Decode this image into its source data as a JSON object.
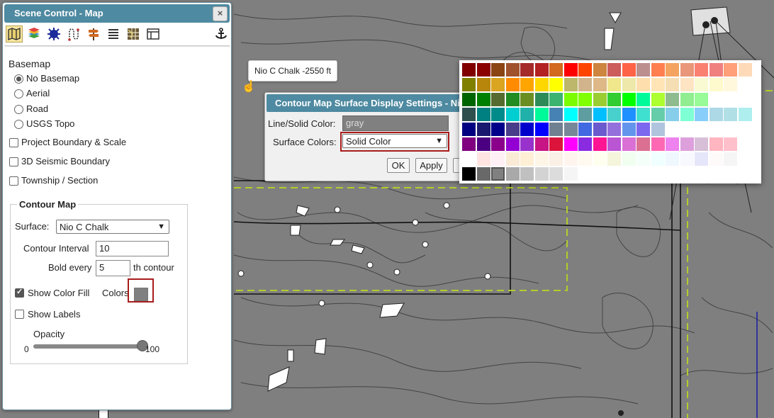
{
  "scene_control": {
    "title": "Scene Control - Map",
    "close_glyph": "×",
    "toolbar": [
      "map-icon",
      "layers-icon",
      "seismic-icon",
      "wells-icon",
      "signpost-icon",
      "list-icon",
      "grid-icon",
      "layout-icon",
      "anchor-icon"
    ],
    "basemap": {
      "heading": "Basemap",
      "options": [
        "No Basemap",
        "Aerial",
        "Road",
        "USGS Topo"
      ],
      "selected": "No Basemap"
    },
    "checkboxes": [
      {
        "label": "Project Boundary & Scale",
        "checked": false
      },
      {
        "label": "3D Seismic Boundary",
        "checked": false
      },
      {
        "label": "Township / Section",
        "checked": false
      }
    ],
    "contour_map": {
      "legend": "Contour Map",
      "surface_label": "Surface:",
      "surface_value": "Nio C Chalk",
      "interval_label": "Contour Interval",
      "interval_value": "10",
      "bold_label": "Bold every",
      "bold_value": "5",
      "bold_suffix": "th contour",
      "show_color_fill_label": "Show Color Fill",
      "show_color_fill": true,
      "colors_label": "Colors",
      "show_labels_label": "Show Labels",
      "show_labels": false,
      "opacity_label": "Opacity",
      "opacity_min": "0",
      "opacity_max": "100",
      "opacity_value": 100
    }
  },
  "tooltip": {
    "text": "Nio C Chalk -2550 ft"
  },
  "dialog": {
    "title": "Contour Map Surface Display Settings - Nio ...",
    "line_color_label": "Line/Solid Color:",
    "line_color_value": "gray",
    "surface_colors_label": "Surface Colors:",
    "surface_colors_value": "Solid Color",
    "ok_label": "OK",
    "apply_label": "Apply"
  },
  "palette": {
    "selected": "#808080",
    "rows": [
      [
        "#800000",
        "#8b0000",
        "#8b4513",
        "#a0522d",
        "#a52a2a",
        "#b22222",
        "#d2691e",
        "#ff0000",
        "#ff4500",
        "#cd853f",
        "#cd5c5c",
        "#ff6347",
        "#bc8f8f",
        "#ff7f50",
        "#f4a460",
        "#e9967a",
        "#fa8072",
        "#f08080",
        "#ffa07a",
        "#ffdab9"
      ],
      [
        "#808000",
        "#b8860b",
        "#daa520",
        "#ff8c00",
        "#ffa500",
        "#ffd700",
        "#ffff00",
        "#bdb76b",
        "#d2b48c",
        "#deb887",
        "#f0e68c",
        "#eee8aa",
        "#ffdead",
        "#ffe4b5",
        "#f5deb3",
        "#ffe4c4",
        "#fafad2",
        "#fffacd",
        "#fff8dc",
        ""
      ],
      [
        "#006400",
        "#008000",
        "#556b2f",
        "#228b22",
        "#6b8e23",
        "#2e8b57",
        "#3cb371",
        "#7cfc00",
        "#7fff00",
        "#9acd32",
        "#32cd32",
        "#00ff00",
        "#00fa9a",
        "#adff2f",
        "#8fbc8f",
        "#90ee90",
        "#98fb98",
        "",
        "",
        ""
      ],
      [
        "#2f4f4f",
        "#008080",
        "#008b8b",
        "#00ced1",
        "#20b2aa",
        "#00fa9a",
        "#4682b4",
        "#00ffff",
        "#5f9ea0",
        "#00bfff",
        "#48d1cc",
        "#1e90ff",
        "#40e0d0",
        "#66cdaa",
        "#87ceeb",
        "#7fffd4",
        "#87cefa",
        "#add8e6",
        "#b0e0e6",
        "#afeeee"
      ],
      [
        "#000080",
        "#191970",
        "#00008b",
        "#483d8b",
        "#0000cd",
        "#0000ff",
        "#708090",
        "#778899",
        "#4169e1",
        "#6a5acd",
        "#9370db",
        "#6495ed",
        "#7b68ee",
        "#b0c4de",
        "",
        "",
        "",
        "",
        "",
        ""
      ],
      [
        "#800080",
        "#4b0082",
        "#8b008b",
        "#9400d3",
        "#9932cc",
        "#c71585",
        "#dc143c",
        "#ff00ff",
        "#8a2be2",
        "#ff1493",
        "#ba55d3",
        "#da70d6",
        "#db7093",
        "#ff69b4",
        "#ee82ee",
        "#dda0dd",
        "#d8bfd8",
        "#ffb6c1",
        "#ffc0cb",
        ""
      ],
      [
        "#ffffff",
        "#ffe4e1",
        "#fff0f5",
        "#faebd7",
        "#ffefd5",
        "#fdf5e6",
        "#faf0e6",
        "#fff5ee",
        "#fffaf0",
        "#fffff0",
        "#f5f5dc",
        "#f0fff0",
        "#f5fffa",
        "#f0ffff",
        "#f0f8ff",
        "#f8f8ff",
        "#e6e6fa",
        "#fffafa",
        "#f5f5f5",
        ""
      ],
      [
        "#000000",
        "#696969",
        "#808080",
        "#a9a9a9",
        "#c0c0c0",
        "#d3d3d3",
        "#dcdcdc",
        "#f5f5f5",
        "#ffffff",
        "",
        "",
        "",
        "",
        "",
        "",
        "",
        "",
        "",
        "",
        ""
      ]
    ]
  }
}
